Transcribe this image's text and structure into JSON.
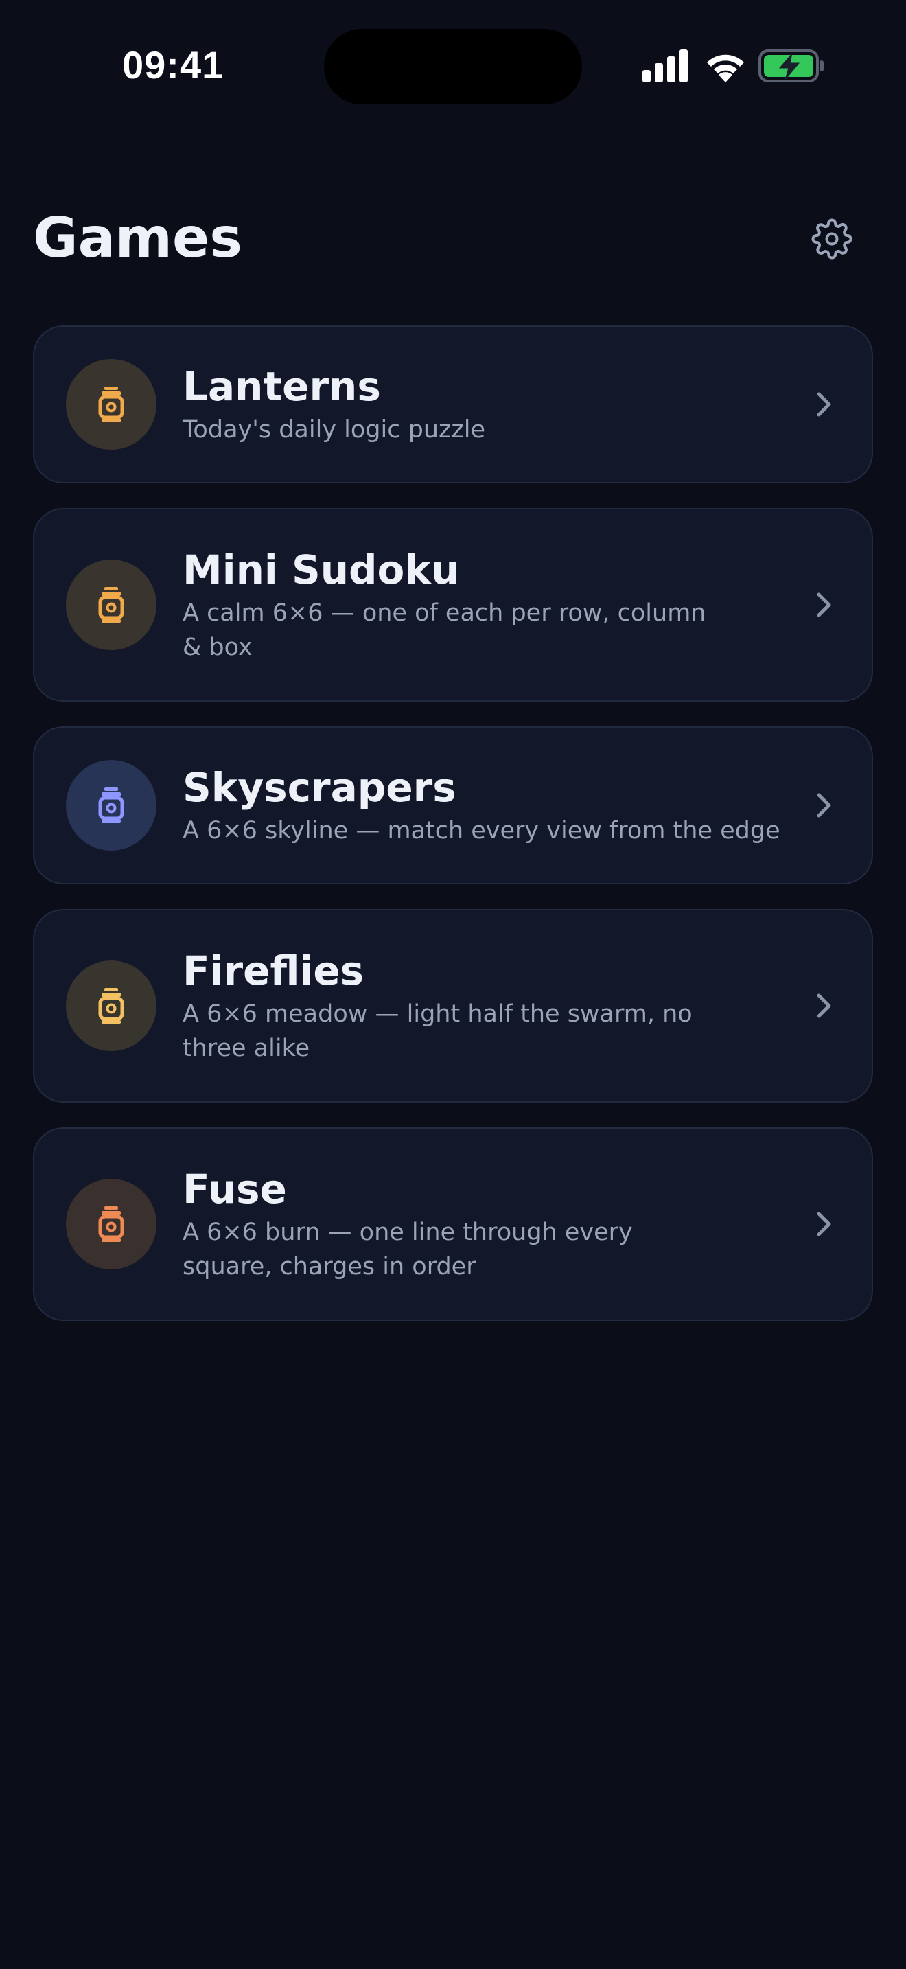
{
  "status_bar": {
    "time": "09:41"
  },
  "header": {
    "title": "Games"
  },
  "colors": {
    "background": "#0b0e18",
    "card": "#12172a",
    "card_border": "#222a40",
    "title_text": "#eef1f8",
    "secondary_text": "#9aa3b8",
    "amber_accent": "#f0a94b",
    "blue_accent": "#8d97ff",
    "battery_green": "#34c759"
  },
  "games": [
    {
      "title": "Lanterns",
      "description": "Today's daily logic puzzle",
      "icon": "lantern-icon",
      "icon_color": "#f0a94b",
      "icon_bg": "#3a342e"
    },
    {
      "title": "Mini Sudoku",
      "description": "A calm 6×6 — one of each per row, column & box",
      "icon": "lantern-icon",
      "icon_color": "#f0a94b",
      "icon_bg": "#3a342e"
    },
    {
      "title": "Skyscrapers",
      "description": "A 6×6 skyline — match every view from the edge",
      "icon": "lantern-icon",
      "icon_color": "#8d97ff",
      "icon_bg": "#283456"
    },
    {
      "title": "Fireflies",
      "description": "A 6×6 meadow — light half the swarm, no three alike",
      "icon": "lantern-icon",
      "icon_color": "#f3c062",
      "icon_bg": "#38352f"
    },
    {
      "title": "Fuse",
      "description": "A 6×6 burn — one line through every square, charges in order",
      "icon": "lantern-icon",
      "icon_color": "#f08a55",
      "icon_bg": "#3a302e"
    }
  ]
}
